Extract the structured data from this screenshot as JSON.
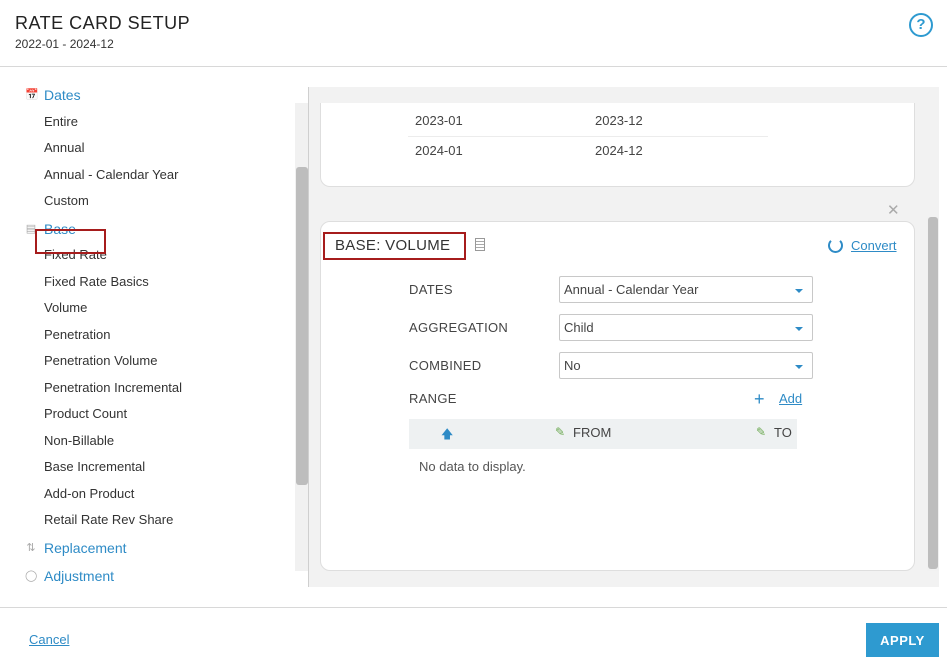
{
  "header": {
    "title": "RATE CARD SETUP",
    "subtitle": "2022-01 - 2024-12",
    "help_label": "?"
  },
  "sidebar": {
    "groups": [
      {
        "label": "Dates",
        "icon": "calendar-icon"
      },
      {
        "label": "Base",
        "icon": "document-icon"
      },
      {
        "label": "Replacement",
        "icon": "swap-icon"
      },
      {
        "label": "Adjustment",
        "icon": "shield-icon"
      }
    ],
    "date_items": [
      "Entire",
      "Annual",
      "Annual - Calendar Year",
      "Custom"
    ],
    "base_items": [
      "Fixed Rate",
      "Fixed Rate Basics",
      "Volume",
      "Penetration",
      "Penetration Volume",
      "Penetration Incremental",
      "Product Count",
      "Non-Billable",
      "Base Incremental",
      "Add-on Product",
      "Retail Rate Rev Share"
    ],
    "selected": "Volume"
  },
  "dates_table": {
    "rows": [
      {
        "from": "2023-01",
        "to": "2023-12"
      },
      {
        "from": "2024-01",
        "to": "2024-12"
      }
    ]
  },
  "base_card": {
    "title": "BASE: VOLUME",
    "convert_label": "Convert",
    "fields": [
      {
        "label": "DATES",
        "value": "Annual - Calendar Year"
      },
      {
        "label": "AGGREGATION",
        "value": "Child"
      },
      {
        "label": "COMBINED",
        "value": "No"
      }
    ],
    "range_label": "RANGE",
    "add_label": "Add",
    "grid_columns": [
      "FROM",
      "TO"
    ],
    "no_data": "No data to display."
  },
  "footer": {
    "cancel_label": "Cancel",
    "apply_label": "APPLY"
  },
  "colors": {
    "accent": "#2e8bc6",
    "highlight_border": "#a61c1c",
    "apply_bg": "#2e9ad0"
  }
}
